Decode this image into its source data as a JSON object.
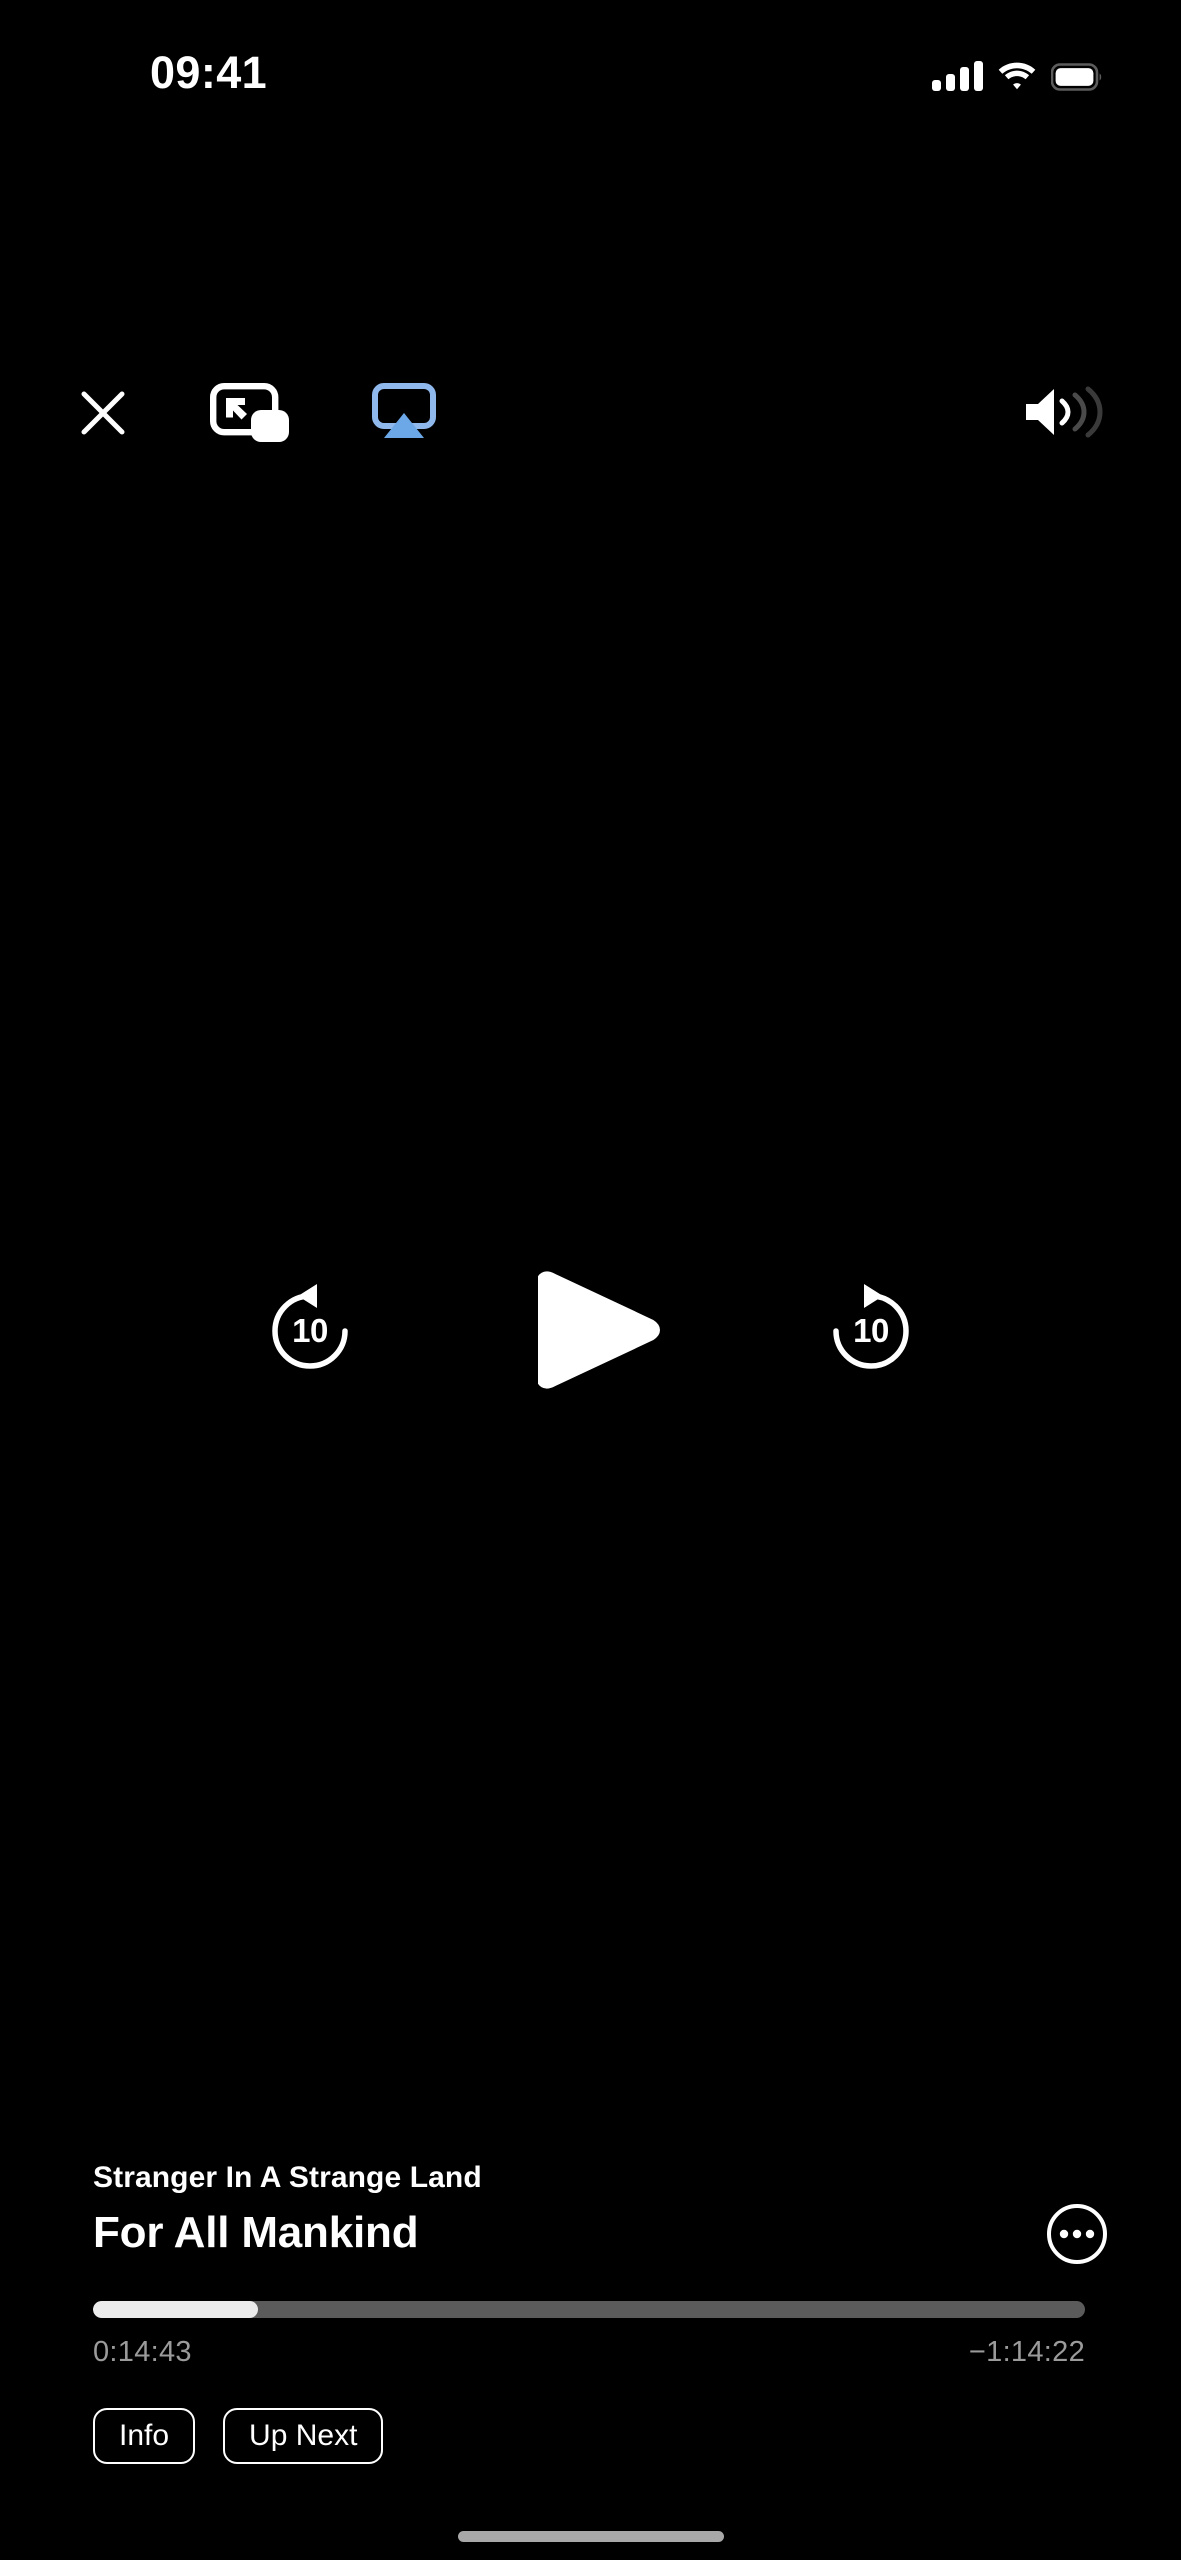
{
  "status_bar": {
    "time": "09:41",
    "cellular_icon": "cellular-signal-icon",
    "wifi_icon": "wifi-icon",
    "battery_icon": "battery-icon",
    "signal_bars_filled": 4,
    "signal_bars_total": 4
  },
  "top_controls": {
    "close_icon": "close-icon",
    "close_label": "Close",
    "pip_icon": "picture-in-picture-icon",
    "pip_label": "Picture in Picture",
    "airplay_icon": "airplay-icon",
    "airplay_label": "AirPlay",
    "airplay_color": "#8fb8ec",
    "volume_icon": "volume-icon",
    "volume_label": "Volume"
  },
  "transport": {
    "skip_back_icon": "skip-back-10-icon",
    "skip_back_seconds": "10",
    "play_icon": "play-icon",
    "play_label": "Play",
    "skip_forward_icon": "skip-forward-10-icon",
    "skip_forward_seconds": "10"
  },
  "now_playing": {
    "episode_title": "Stranger In A Strange Land",
    "show_title": "For All Mankind",
    "more_icon": "more-ellipsis-icon",
    "more_label": "More"
  },
  "progress": {
    "elapsed": "0:14:43",
    "remaining": "−1:14:22",
    "percent": 16.6,
    "fill_color": "#ececec",
    "track_color": "#5b5b5b"
  },
  "actions": {
    "info_label": "Info",
    "up_next_label": "Up Next"
  },
  "home_indicator": {
    "color": "#a8a8a8"
  }
}
